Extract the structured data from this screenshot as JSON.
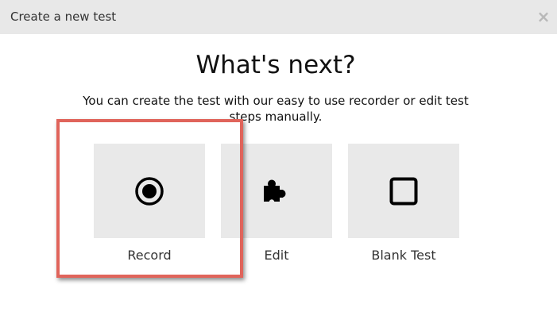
{
  "dialog": {
    "title": "Create a new test",
    "close_label": "×"
  },
  "content": {
    "heading": "What's next?",
    "description": "You can create the test with our easy to use recorder or edit test steps manually."
  },
  "options": [
    {
      "label": "Record",
      "icon": "record-icon"
    },
    {
      "label": "Edit",
      "icon": "puzzle-piece-icon"
    },
    {
      "label": "Blank Test",
      "icon": "square-icon"
    }
  ],
  "highlight": {
    "target": "Record",
    "color": "#e0645b"
  }
}
